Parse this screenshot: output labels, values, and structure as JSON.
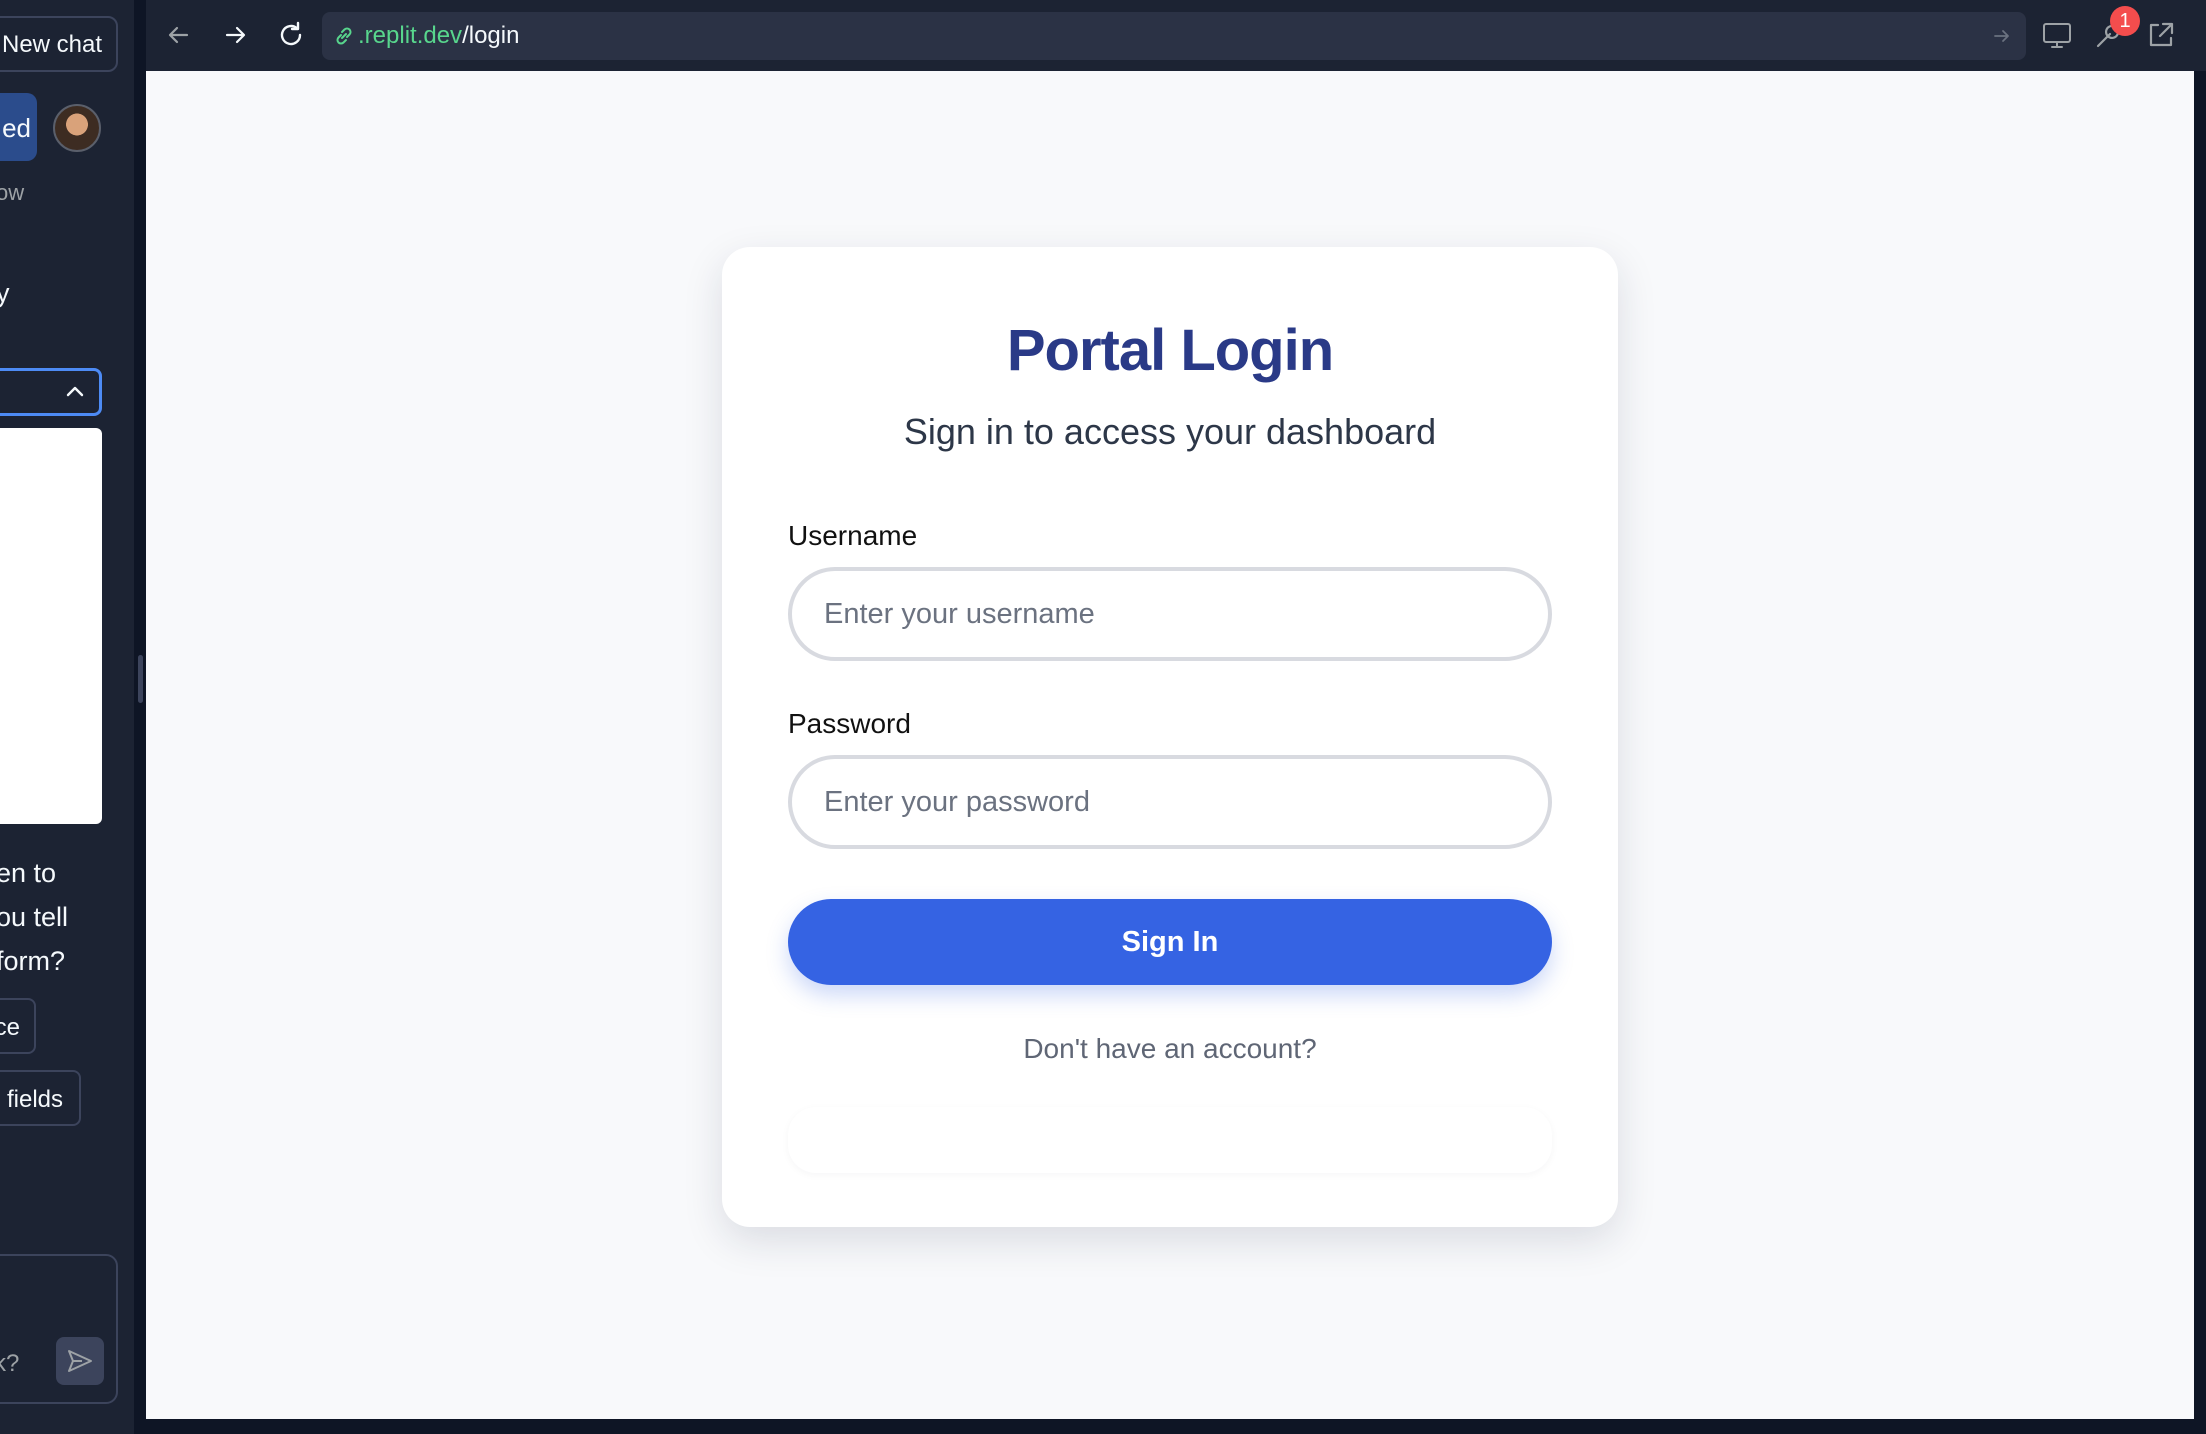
{
  "chat_panel": {
    "new_chat_label": "New chat",
    "active_tab_fragment": "ed",
    "muted_fragment": "ow",
    "line_fragment": "y",
    "message_lines": [
      "en to",
      "ou tell",
      "form?"
    ],
    "chip_1_fragment": "ce",
    "chip_2_fragment": "fields",
    "input_hint_fragment": "k?"
  },
  "browser": {
    "url_domain": ".replit.dev",
    "url_path": "/login",
    "notification_count": "1"
  },
  "login": {
    "title": "Portal Login",
    "subtitle": "Sign in to access your dashboard",
    "username_label": "Username",
    "username_placeholder": "Enter your username",
    "password_label": "Password",
    "password_placeholder": "Enter your password",
    "signin_label": "Sign In",
    "signup_prompt": "Don't have an account?"
  },
  "colors": {
    "title": "#2a3a87",
    "primary_button": "#3563e3",
    "url_domain": "#58d68d",
    "badge": "#f44d4d",
    "panel_background": "#1c2333"
  }
}
